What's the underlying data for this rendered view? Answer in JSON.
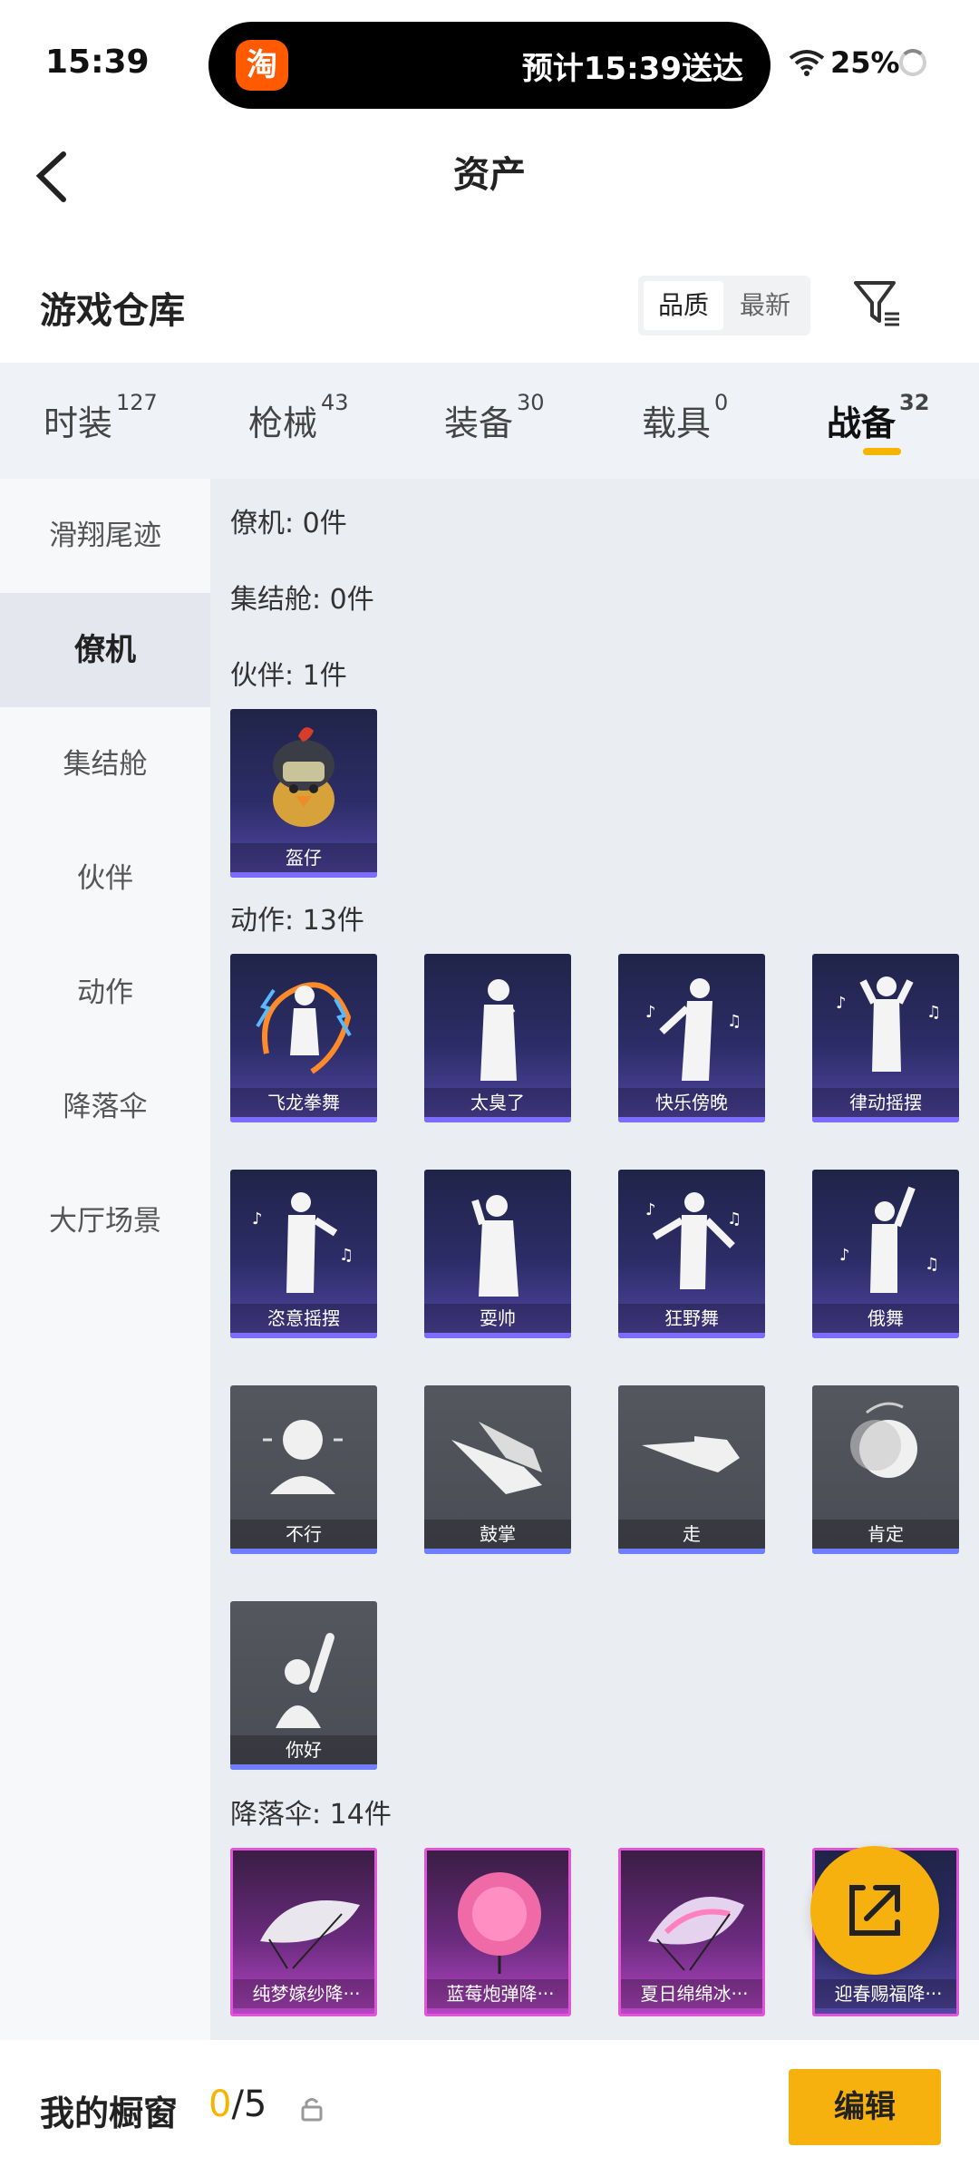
{
  "status_bar": {
    "time": "15:39",
    "island_text": "预计15:39送达",
    "island_logo": "淘",
    "battery": "25%"
  },
  "nav": {
    "title": "资产"
  },
  "warehouse": {
    "title": "游戏仓库",
    "sort_options": [
      "品质",
      "最新"
    ]
  },
  "tabs": [
    {
      "label": "时装",
      "count": "127"
    },
    {
      "label": "枪械",
      "count": "43"
    },
    {
      "label": "装备",
      "count": "30"
    },
    {
      "label": "载具",
      "count": "0"
    },
    {
      "label": "战备",
      "count": "32"
    }
  ],
  "sidebar": [
    "滑翔尾迹",
    "僚机",
    "集结舱",
    "伙伴",
    "动作",
    "降落伞",
    "大厅场景"
  ],
  "sections": {
    "liaoji": "僚机: 0件",
    "jijiecang": "集结舱: 0件",
    "huoban": "伙伴: 1件",
    "dongzuo": "动作: 13件",
    "jiangluosan": "降落伞: 14件"
  },
  "partners": [
    "盔仔"
  ],
  "actions": [
    "飞龙拳舞",
    "太臭了",
    "快乐傍晚",
    "律动摇摆",
    "恣意摇摆",
    "耍帅",
    "狂野舞",
    "俄舞",
    "不行",
    "鼓掌",
    "走",
    "肯定",
    "你好"
  ],
  "parachutes": [
    "纯梦嫁纱降···",
    "蓝莓炮弹降···",
    "夏日绵绵冰···",
    "迎春赐福降···"
  ],
  "bottom": {
    "label": "我的橱窗",
    "current": "0",
    "total": "/5",
    "edit": "编辑"
  }
}
